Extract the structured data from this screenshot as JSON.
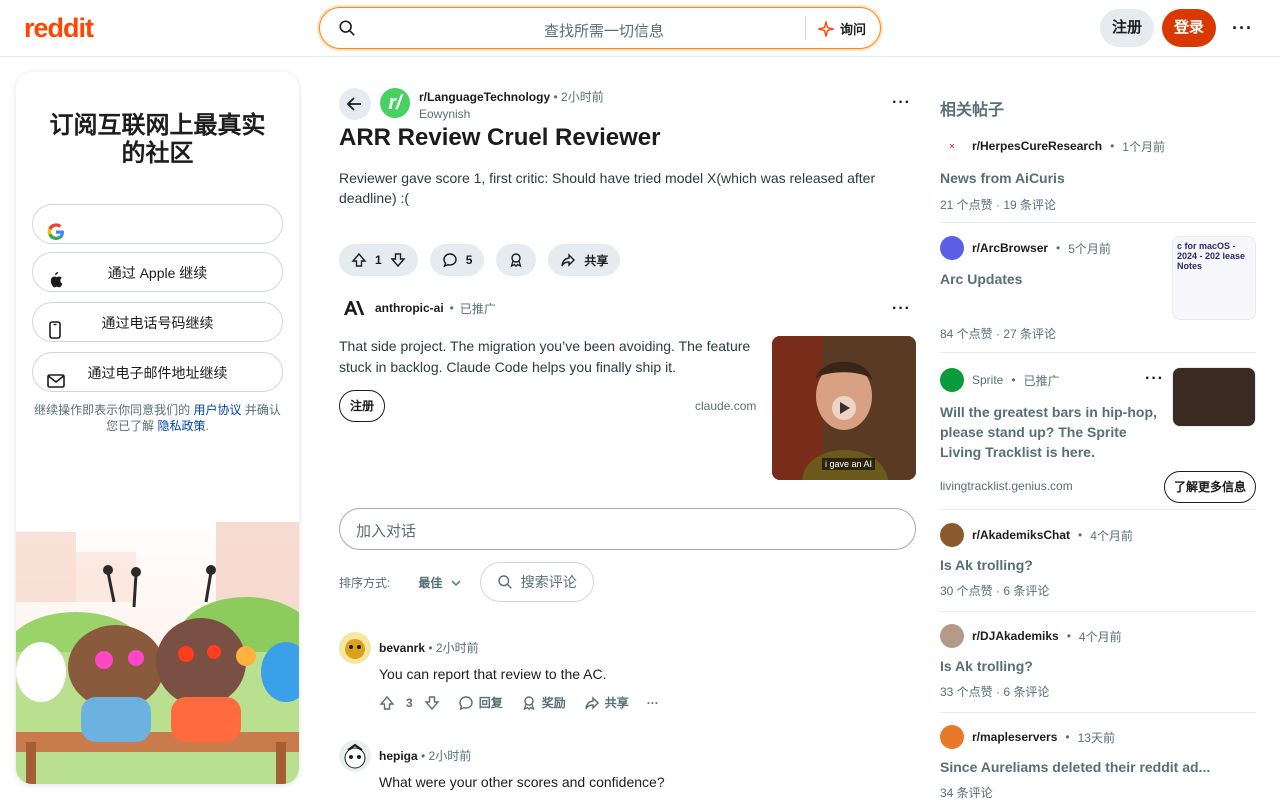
{
  "header": {
    "logo": "reddit",
    "search_placeholder": "查找所需一切信息",
    "ask_label": "询问",
    "signup_label": "注册",
    "login_label": "登录",
    "more_label": "···"
  },
  "left": {
    "title": "订阅互联网上最真实的社区",
    "google_label": "",
    "apple_label": "通过 Apple 继续",
    "phone_label": "通过电话号码继续",
    "email_label": "通过电子邮件地址继续",
    "legal_prefix": "继续操作即表示你同意我们的",
    "legal_agreement": "用户协议",
    "legal_mid": "并确认您已了解",
    "legal_privacy": "隐私政策",
    "legal_suffix": "."
  },
  "post": {
    "subreddit": "r/LanguageTechnology",
    "time": "2小时前",
    "author": "Eowynish",
    "title": "ARR Review Cruel Reviewer",
    "body": "Reviewer gave score 1, first critic: Should have tried model X(which was released after deadline) :(",
    "votes": "1",
    "comments": "5",
    "share_label": "共享",
    "more_label": "···"
  },
  "ad": {
    "advertiser": "anthropic-ai",
    "promoted": "已推广",
    "text": "That side project. The migration you’ve been avoiding. The feature stuck in backlog. Claude Code helps you finally ship it.",
    "cta": "注册",
    "domain": "claude.com",
    "caption": "i gave an AI",
    "more_label": "···"
  },
  "comments_section": {
    "input_placeholder": "加入对话",
    "sort_label": "排序方式:",
    "sort_value": "最佳",
    "search_placeholder": "搜索评论"
  },
  "comments": [
    {
      "user": "bevanrk",
      "time": "2小时前",
      "text": "You can report that review to the AC.",
      "votes": "3",
      "reply": "回复",
      "award": "奖励",
      "share": "共享",
      "more": "···"
    },
    {
      "user": "hepiga",
      "time": "2小时前",
      "text": "What were your other scores and confidence?"
    }
  ],
  "related": {
    "title": "相关帖子",
    "items": [
      {
        "sub": "r/HerpesCureResearch",
        "time": "1个月前",
        "title": "News from AiCuris",
        "likes": "21 个点赞",
        "comments": "19 条评论"
      },
      {
        "sub": "r/ArcBrowser",
        "time": "5个月前",
        "title": "Arc Updates",
        "likes": "84 个点赞",
        "comments": "27 条评论",
        "thumb_text": "c for macOS - 2024 - 202 lease Notes"
      },
      {
        "sub": "Sprite",
        "time": "已推广",
        "title": "Will the greatest bars in hip-hop, please stand up? The Sprite Living Tracklist is here.",
        "domain": "livingtracklist.genius.com",
        "cta": "了解更多信息",
        "more": "···"
      },
      {
        "sub": "r/AkademiksChat",
        "time": "4个月前",
        "title": "Is Ak trolling?",
        "likes": "30 个点赞",
        "comments": "6 条评论"
      },
      {
        "sub": "r/DJAkademiks",
        "time": "4个月前",
        "title": "Is Ak trolling?",
        "likes": "33 个点赞",
        "comments": "6 条评论"
      },
      {
        "sub": "r/mapleservers",
        "time": "13天前",
        "title": "Since Aureliams deleted their reddit ad...",
        "comments": "34 条评论"
      }
    ]
  },
  "colors": {
    "brand": "#ff4500",
    "login": "#d93900",
    "link": "#0045ac",
    "muted": "#576f76"
  }
}
